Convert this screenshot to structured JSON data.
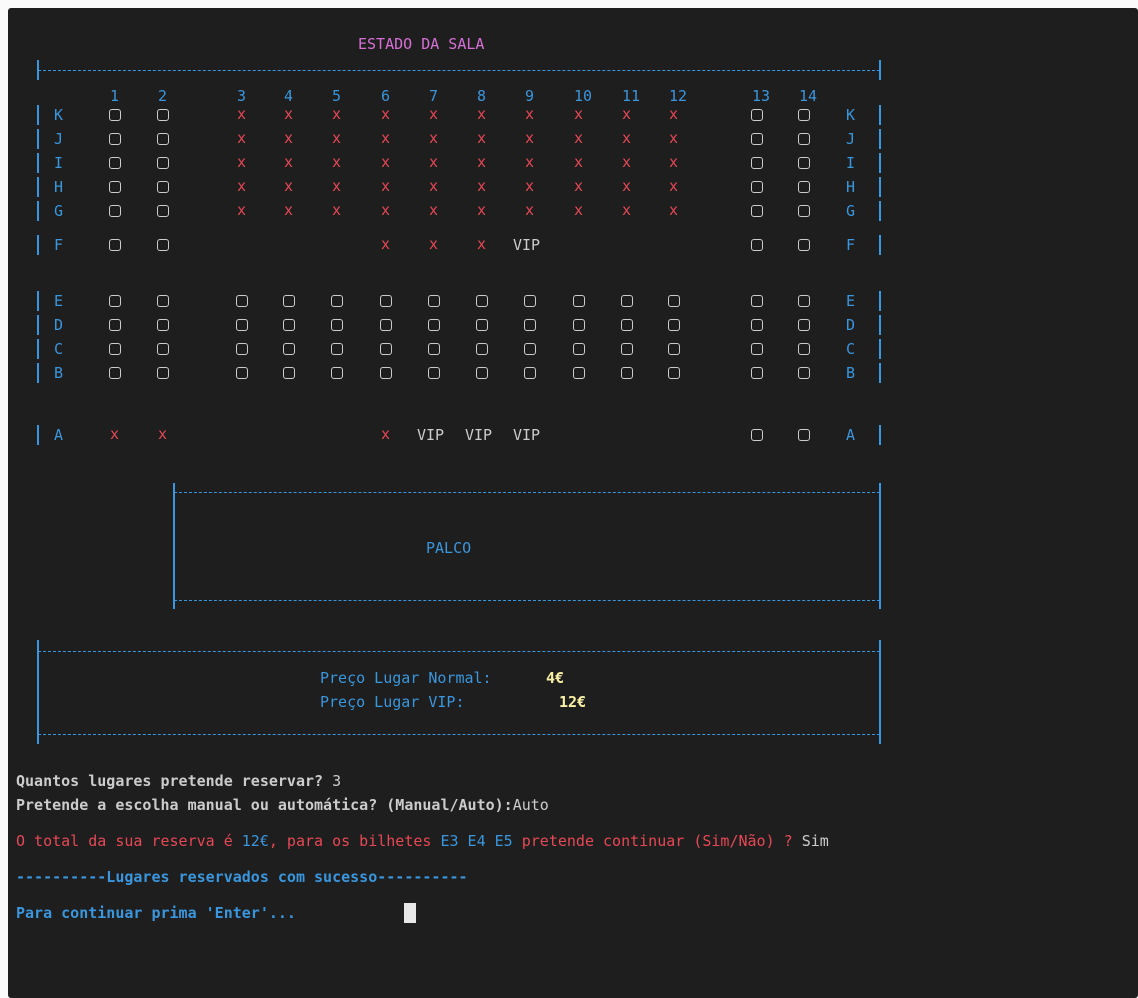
{
  "title": "ESTADO DA SALA",
  "columns": [
    "1",
    "2",
    "3",
    "4",
    "5",
    "6",
    "7",
    "8",
    "9",
    "10",
    "11",
    "12",
    "13",
    "14"
  ],
  "rows": [
    {
      "label": "K",
      "seats": [
        "o",
        "o",
        "x",
        "x",
        "x",
        "x",
        "x",
        "x",
        "x",
        "x",
        "x",
        "x",
        "o",
        "o"
      ]
    },
    {
      "label": "J",
      "seats": [
        "o",
        "o",
        "x",
        "x",
        "x",
        "x",
        "x",
        "x",
        "x",
        "x",
        "x",
        "x",
        "o",
        "o"
      ]
    },
    {
      "label": "I",
      "seats": [
        "o",
        "o",
        "x",
        "x",
        "x",
        "x",
        "x",
        "x",
        "x",
        "x",
        "x",
        "x",
        "o",
        "o"
      ]
    },
    {
      "label": "H",
      "seats": [
        "o",
        "o",
        "x",
        "x",
        "x",
        "x",
        "x",
        "x",
        "x",
        "x",
        "x",
        "x",
        "o",
        "o"
      ]
    },
    {
      "label": "G",
      "seats": [
        "o",
        "o",
        "x",
        "x",
        "x",
        "x",
        "x",
        "x",
        "x",
        "x",
        "x",
        "x",
        "o",
        "o"
      ]
    },
    {
      "label": "F",
      "seats": [
        "o",
        "o",
        "",
        "",
        "",
        "x",
        "x",
        "x",
        "VIP",
        "",
        "",
        "",
        "o",
        "o"
      ]
    },
    {
      "label": "E",
      "seats": [
        "o",
        "o",
        "o",
        "o",
        "o",
        "o",
        "o",
        "o",
        "o",
        "o",
        "o",
        "o",
        "o",
        "o"
      ]
    },
    {
      "label": "D",
      "seats": [
        "o",
        "o",
        "o",
        "o",
        "o",
        "o",
        "o",
        "o",
        "o",
        "o",
        "o",
        "o",
        "o",
        "o"
      ]
    },
    {
      "label": "C",
      "seats": [
        "o",
        "o",
        "o",
        "o",
        "o",
        "o",
        "o",
        "o",
        "o",
        "o",
        "o",
        "o",
        "o",
        "o"
      ]
    },
    {
      "label": "B",
      "seats": [
        "o",
        "o",
        "o",
        "o",
        "o",
        "o",
        "o",
        "o",
        "o",
        "o",
        "o",
        "o",
        "o",
        "o"
      ]
    },
    {
      "label": "A",
      "seats": [
        "x",
        "x",
        "",
        "",
        "",
        "x",
        "VIP",
        "VIP",
        "VIP",
        "",
        "",
        "",
        "o",
        "o"
      ]
    }
  ],
  "stage": "PALCO",
  "prices": {
    "normal_label": "Preço Lugar Normal:",
    "normal_value": "4€",
    "vip_label": "Preço Lugar VIP:",
    "vip_value": "12€"
  },
  "prompts": {
    "q1": "Quantos lugares pretende reservar?",
    "a1": "3",
    "q2": "Pretende a escolha manual ou automática? (Manual/Auto):",
    "a2": "Auto",
    "total_pre": "O total da sua reserva é ",
    "total_value": "12€",
    "total_mid": ", para os bilhetes ",
    "tickets": "E3 E4 E5",
    "total_post": " pretende continuar (Sim/Não) ? ",
    "a3": "Sim",
    "success": "----------Lugares reservados com sucesso----------",
    "enter": "Para continuar prima 'Enter'..."
  },
  "colors": {
    "background": "#1e1e1e",
    "blue": "#3a96dd",
    "magenta": "#d670d6",
    "red": "#e74856",
    "yellow": "#f9f1a5",
    "white": "#cccccc"
  }
}
